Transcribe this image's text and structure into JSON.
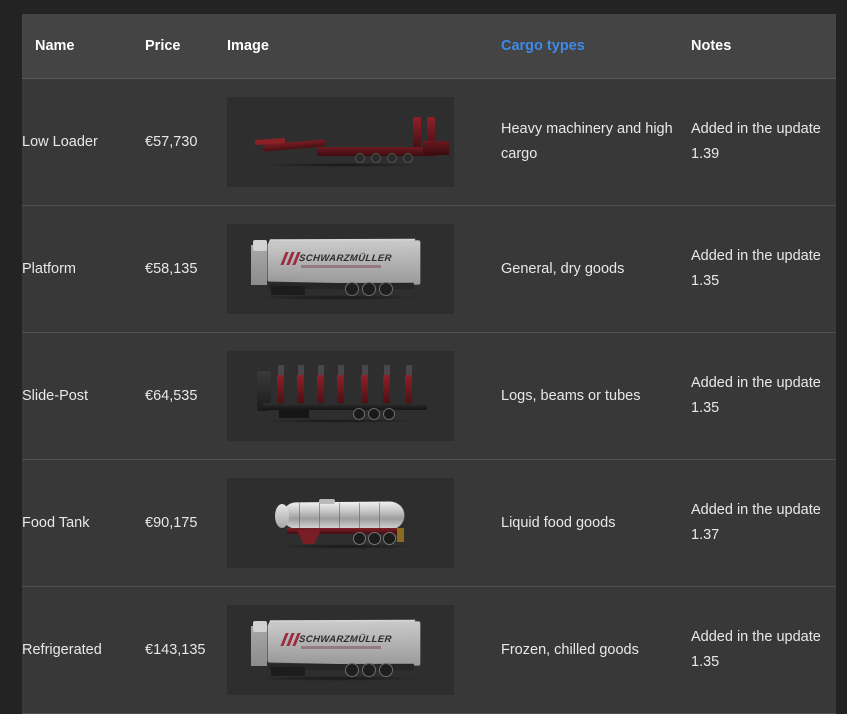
{
  "table": {
    "columns": [
      {
        "key": "name",
        "label": "Name",
        "link": false
      },
      {
        "key": "price",
        "label": "Price",
        "link": false
      },
      {
        "key": "image",
        "label": "Image",
        "link": false
      },
      {
        "key": "cargo",
        "label": "Cargo types",
        "link": true
      },
      {
        "key": "notes",
        "label": "Notes",
        "link": false
      }
    ],
    "rows": [
      {
        "name": "Low Loader",
        "price": "€57,730",
        "image_alt": "low-loader-trailer",
        "cargo": "Heavy machinery and high cargo",
        "notes": "Added in the update 1.39"
      },
      {
        "name": "Platform",
        "price": "€58,135",
        "image_alt": "platform-trailer",
        "image_brand": "SCHWARZMÜLLER",
        "cargo": "General, dry goods",
        "notes": "Added in the update 1.35"
      },
      {
        "name": "Slide-Post",
        "price": "€64,535",
        "image_alt": "slide-post-trailer",
        "cargo": "Logs, beams or tubes",
        "notes": "Added in the update 1.35"
      },
      {
        "name": "Food Tank",
        "price": "€90,175",
        "image_alt": "food-tank-trailer",
        "cargo": "Liquid food goods",
        "notes": "Added in the update 1.37"
      },
      {
        "name": "Refrigerated",
        "price": "€143,135",
        "image_alt": "refrigerated-trailer",
        "image_brand": "SCHWARZMÜLLER",
        "cargo": "Frozen, chilled goods",
        "notes": "Added in the update 1.35"
      }
    ]
  },
  "colors": {
    "page_background": "#232323",
    "table_background": "#383838",
    "header_background": "#444444",
    "row_divider": "#4f4f4f",
    "text": "#e8e8e8",
    "header_text": "#ffffff",
    "link": "#3e8ae8",
    "thumb_background": "#2e2e2e"
  }
}
